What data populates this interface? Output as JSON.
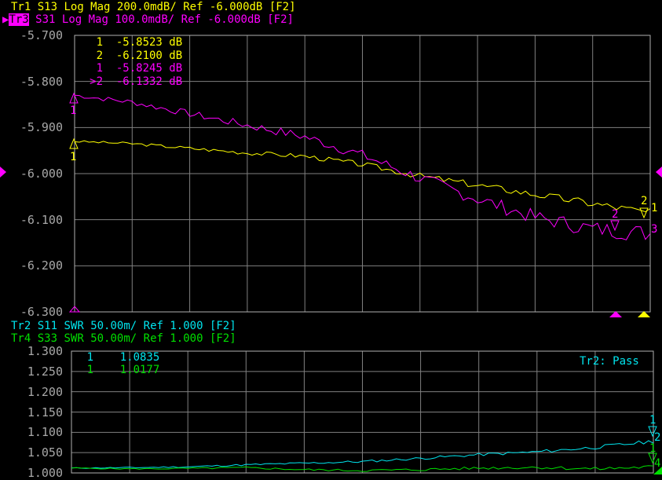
{
  "colors": {
    "tr1": "#ffff00",
    "tr3": "#ff00ff",
    "tr2": "#00e5ee",
    "tr4": "#00e000",
    "grid": "#808080",
    "axis": "#a8a8a8"
  },
  "upper": {
    "tr1": {
      "name": "Tr1",
      "param": "S13",
      "format": "Log Mag",
      "scale": "200.0mdB/",
      "ref": "Ref -6.000dB",
      "ch": "[F2]"
    },
    "tr3": {
      "name": "Tr3",
      "param": "S31",
      "format": "Log Mag",
      "scale": "100.0mdB/",
      "ref": "Ref -6.000dB",
      "ch": "[F2]"
    },
    "markers": [
      {
        "num": "1",
        "value": "-5.8523 dB",
        "trace": "tr1"
      },
      {
        "num": "2",
        "value": "-6.2100 dB",
        "trace": "tr1"
      },
      {
        "num": "1",
        "value": "-5.8245 dB",
        "trace": "tr3"
      },
      {
        "num": ">2",
        "value": "-6.1332 dB",
        "trace": "tr3"
      }
    ],
    "trace_labels": {
      "tr1_start": "1",
      "tr3_start": "1",
      "tr1_end": "1",
      "tr3_end": "3",
      "tr1_m2": "2",
      "tr3_m2": "2"
    }
  },
  "lower": {
    "tr2": {
      "name": "Tr2",
      "param": "S11",
      "format": "SWR",
      "scale": "50.00m/",
      "ref": "Ref 1.000",
      "ch": "[F2]"
    },
    "tr4": {
      "name": "Tr4",
      "param": "S33",
      "format": "SWR",
      "scale": "50.00m/",
      "ref": "Ref 1.000",
      "ch": "[F2]"
    },
    "markers": [
      {
        "num": "1",
        "value": "1.0835",
        "trace": "tr2"
      },
      {
        "num": "1",
        "value": "1.0177",
        "trace": "tr4"
      }
    ],
    "limit_status": "Tr2: Pass",
    "trace_labels": {
      "tr2_m": "1",
      "tr2_end": "2",
      "tr4_m": "1",
      "tr4_end": "4"
    }
  },
  "chart_data": [
    {
      "type": "line",
      "title": "Tr1 S13 / Tr3 S31 Log Mag",
      "ylabel": "dB",
      "ylim": [
        -6.3,
        -5.7
      ],
      "yticks": [
        "-5.700",
        "-5.800",
        "-5.900",
        "-6.000",
        "-6.100",
        "-6.200",
        "-6.300"
      ],
      "grid": true,
      "x_divisions": 10,
      "series": [
        {
          "name": "Tr1 S13",
          "values": [
            -5.93,
            -5.935,
            -5.945,
            -5.955,
            -5.962,
            -5.98,
            -6.005,
            -6.025,
            -6.045,
            -6.065,
            -6.085
          ]
        },
        {
          "name": "Tr3 S31",
          "values": [
            -5.83,
            -5.845,
            -5.87,
            -5.895,
            -5.92,
            -5.96,
            -6.01,
            -6.055,
            -6.095,
            -6.12,
            -6.13
          ]
        }
      ]
    },
    {
      "type": "line",
      "title": "Tr2 S11 / Tr4 S33 SWR",
      "ylabel": "SWR",
      "ylim": [
        1.0,
        1.3
      ],
      "yticks": [
        "1.300",
        "1.250",
        "1.200",
        "1.150",
        "1.100",
        "1.050",
        "1.000"
      ],
      "grid": true,
      "x_divisions": 10,
      "series": [
        {
          "name": "Tr2 S11",
          "values": [
            1.012,
            1.013,
            1.015,
            1.02,
            1.024,
            1.028,
            1.036,
            1.045,
            1.052,
            1.063,
            1.078
          ]
        },
        {
          "name": "Tr4 S33",
          "values": [
            1.012,
            1.01,
            1.011,
            1.013,
            1.008,
            1.006,
            1.008,
            1.012,
            1.014,
            1.01,
            1.015
          ]
        }
      ]
    }
  ]
}
